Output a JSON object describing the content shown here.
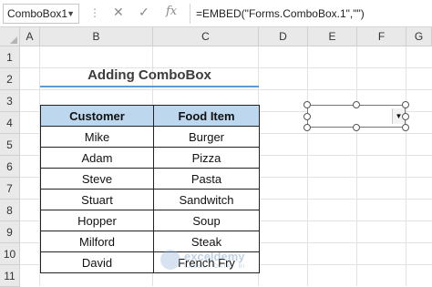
{
  "formula_bar": {
    "name_box": "ComboBox1",
    "dots": "⋮",
    "cancel_icon": "✕",
    "enter_icon": "✓",
    "fx_label": "fx",
    "formula": "=EMBED(\"Forms.ComboBox.1\",\"\")"
  },
  "columns": [
    "A",
    "B",
    "C",
    "D",
    "E",
    "F",
    "G"
  ],
  "rows": [
    "1",
    "2",
    "3",
    "4",
    "5",
    "6",
    "7",
    "8",
    "9",
    "10",
    "11"
  ],
  "sheet": {
    "title": "Adding ComboBox",
    "title_underline_color": "#5b9bd5",
    "header_fill": "#bdd7ee",
    "table": {
      "headers": [
        "Customer",
        "Food Item"
      ],
      "rows": [
        [
          "Mike",
          "Burger"
        ],
        [
          "Adam",
          "Pizza"
        ],
        [
          "Steve",
          "Pasta"
        ],
        [
          "Stuart",
          "Sandwitch"
        ],
        [
          "Hopper",
          "Soup"
        ],
        [
          "Milford",
          "Steak"
        ],
        [
          "David",
          "French Fry"
        ]
      ]
    }
  },
  "combobox": {
    "value": "",
    "dropdown_icon": "chevron-down-icon"
  },
  "watermark": {
    "name": "exceldemy",
    "tagline": "EXCEL · DATA · BI"
  }
}
